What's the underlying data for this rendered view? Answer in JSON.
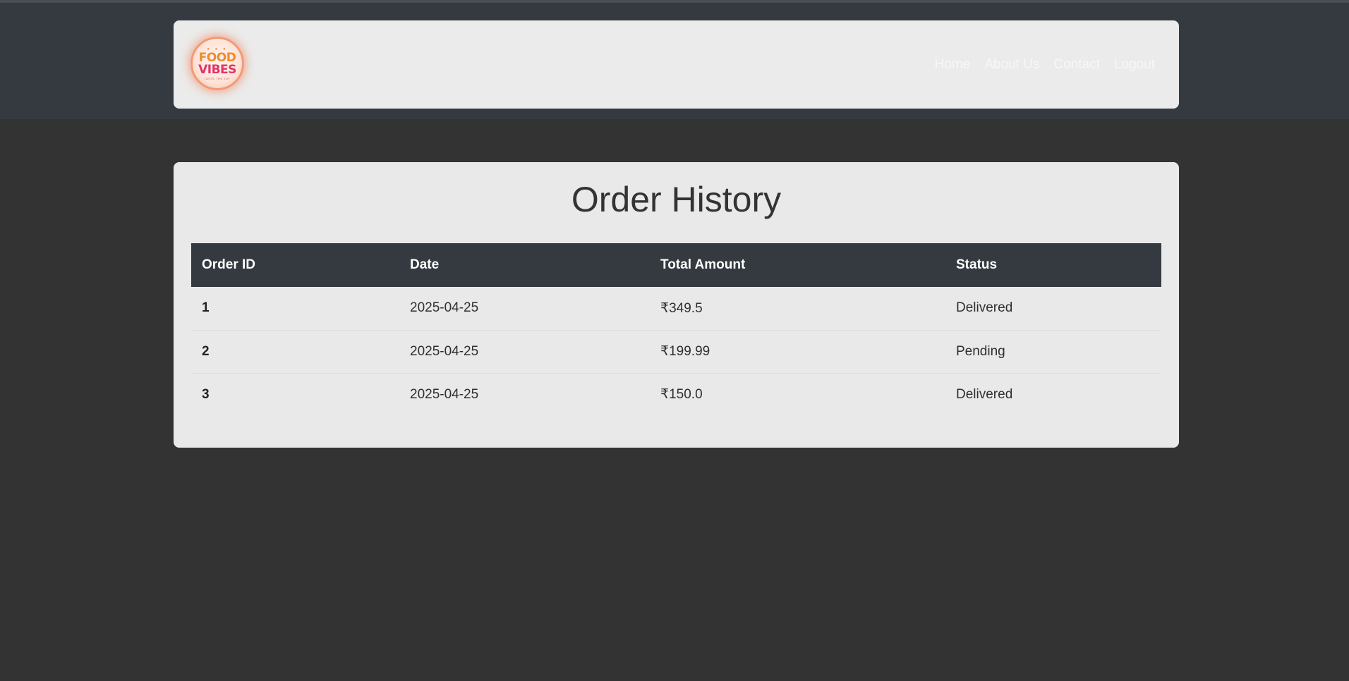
{
  "brand": {
    "logo_line1": "FOOD",
    "logo_line2": "VIBES",
    "logo_tagline": "TASTE THE JOY",
    "accent_orange": "#f08a2e",
    "accent_pink": "#e2336b"
  },
  "nav": {
    "items": [
      {
        "label": "Home"
      },
      {
        "label": "About Us"
      },
      {
        "label": "Contact"
      },
      {
        "label": "Logout"
      }
    ]
  },
  "page": {
    "title": "Order History"
  },
  "orders": {
    "columns": [
      "Order ID",
      "Date",
      "Total Amount",
      "Status"
    ],
    "rows": [
      {
        "id": "1",
        "date": "2025-04-25",
        "total": "₹349.5",
        "status": "Delivered"
      },
      {
        "id": "2",
        "date": "2025-04-25",
        "total": "₹199.99",
        "status": "Pending"
      },
      {
        "id": "3",
        "date": "2025-04-25",
        "total": "₹150.0",
        "status": "Delivered"
      }
    ]
  },
  "colors": {
    "header_background": "#343a40",
    "page_background": "#333333",
    "card_background": "#e9e9e9"
  }
}
